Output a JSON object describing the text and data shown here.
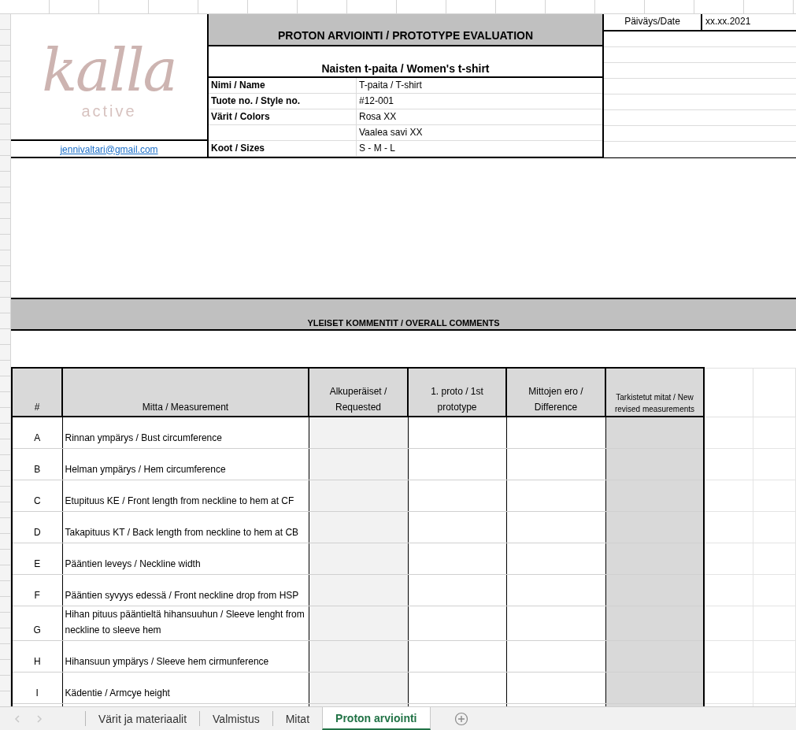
{
  "header": {
    "brand": "kalla",
    "tagline": "active",
    "email": "jennivaltari@gmail.com",
    "title": "PROTON ARVIOINTI / PROTOTYPE EVALUATION",
    "subtitle": "Naisten t-paita / Women's t-shirt",
    "date_label": "Päiväys/Date",
    "date_value": "xx.xx.2021"
  },
  "info_rows": [
    {
      "label": "Nimi / Name",
      "value": "T-paita / T-shirt"
    },
    {
      "label": "Tuote no. / Style no.",
      "value": "#12-001"
    },
    {
      "label": "Värit / Colors",
      "value": "Rosa XX"
    },
    {
      "value": "Vaalea savi XX"
    },
    {
      "label": "Koot / Sizes",
      "value": "S - M - L"
    }
  ],
  "comments_title": "YLEISET KOMMENTIT / OVERALL COMMENTS",
  "table": {
    "columns": [
      "#",
      "Mitta / Measurement",
      "Alkuperäiset / Requested",
      "1. proto / 1st prototype",
      "Mittojen ero / Difference",
      "Tarkistetut mitat / New revised measurements"
    ],
    "rows": [
      {
        "code": "A",
        "measurement": "Rinnan ympärys /  Bust circumference"
      },
      {
        "code": "B",
        "measurement": "Helman ympärys / Hem circumference"
      },
      {
        "code": "C",
        "measurement": "Etupituus KE / Front length from neckline to hem at CF"
      },
      {
        "code": "D",
        "measurement": "Takapituus KT / Back length from neckline to hem at CB"
      },
      {
        "code": "E",
        "measurement": "Pääntien leveys /  Neckline width"
      },
      {
        "code": "F",
        "measurement": "Pääntien syvyys edessä / Front neckline drop from HSP"
      },
      {
        "code": "G",
        "measurement": "Hihan pituus pääntieltä hihansuuhun / Sleeve lenght from neckline to sleeve hem"
      },
      {
        "code": "H",
        "measurement": "Hihansuun ympärys / Sleeve hem cirmunference"
      },
      {
        "code": "I",
        "measurement": "Kädentie /  Armcye height"
      }
    ]
  },
  "sheet_tabs": [
    {
      "label": "Värit ja materiaalit",
      "selected": false
    },
    {
      "label": "Valmistus",
      "selected": false
    },
    {
      "label": "Mitat",
      "selected": false
    },
    {
      "label": "Proton arviointi",
      "selected": true
    }
  ]
}
